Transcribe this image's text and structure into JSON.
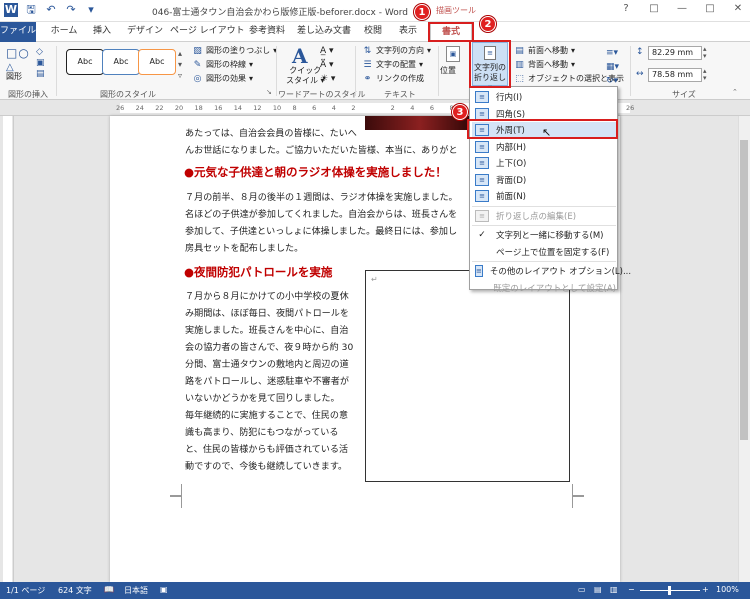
{
  "window": {
    "title": "046-富士通タウン自治会かわら版修正版-beforer.docx - Word",
    "context_tools_label": "描画ツール",
    "buttons": [
      "?",
      "□",
      "—",
      "□",
      "✕"
    ]
  },
  "tabs": [
    "ファイル",
    "ホーム",
    "挿入",
    "デザイン",
    "ページ レイアウト",
    "参考資料",
    "差し込み文書",
    "校閲",
    "表示",
    "書式"
  ],
  "active_tab": "書式",
  "ribbon": {
    "insert_shapes": {
      "label": "図形の挿入",
      "shapes_button": "図形"
    },
    "shape_styles": {
      "label": "図形のスタイル",
      "previews": [
        "Abc",
        "Abc",
        "Abc"
      ],
      "fill": "図形の塗りつぶし",
      "outline": "図形の枠線",
      "effects": "図形の効果"
    },
    "wordart": {
      "label": "ワードアートのスタイル",
      "quick_styles_line1": "クイック",
      "quick_styles_line2": "スタイル"
    },
    "text": {
      "label": "テキスト",
      "direction": "文字列の方向",
      "align": "文字の配置",
      "link": "リンクの作成"
    },
    "arrange": {
      "position": "位置",
      "wrap_line1": "文字列の",
      "wrap_line2": "折り返し",
      "bring_forward": "前面へ移動",
      "send_backward": "背面へ移動",
      "selection_pane": "オブジェクトの選択と表示"
    },
    "size": {
      "label": "サイズ",
      "height": "82.29 mm",
      "width": "78.58 mm"
    }
  },
  "ruler_ticks": [
    "26",
    "24",
    "22",
    "20",
    "18",
    "16",
    "14",
    "12",
    "10",
    "8",
    "6",
    "4",
    "2",
    "",
    "2",
    "4",
    "6",
    "8",
    "10",
    "12",
    "14",
    "16",
    "18",
    "20",
    "22",
    "24",
    "26"
  ],
  "document": {
    "lines_top": [
      "あたっては、自治会会員の皆様に、たいへ",
      "んお世話になりました。ご協力いただいた皆様、本当に、ありがと"
    ],
    "heading1": "●元気な子供達と朝のラジオ体操を実施しました！",
    "para1": [
      "７月の前半、８月の後半の１週間は、ラジオ体操を実施しました。",
      "名ほどの子供達が参加してくれました。自治会からは、班長さんを",
      "参加して、子供達といっしょに体操しました。最終日には、参加し",
      "房具セットを配布しました。"
    ],
    "heading2": "●夜間防犯パトロールを実施",
    "para2": [
      "７月から８月にかけての小中学校の夏休",
      "み期間は、ほぼ毎日、夜間パトロールを",
      "実施しました。班長さんを中心に、自治",
      "会の協力者の皆さんで、夜９時から約 30",
      "分間、富士通タウンの敷地内と周辺の道",
      "路をパトロールし、迷惑駐車や不審者が",
      "いないかどうかを見て回りしました。",
      "毎年継続的に実施することで、住民の意",
      "識も高まり、防犯にもつながっている",
      "と、住民の皆様からも評価されている活",
      "動ですので、今後も継続していきます。"
    ]
  },
  "wrap_menu": {
    "items": [
      {
        "label": "行内(I)",
        "icon": "inline-icon",
        "enabled": true
      },
      {
        "label": "四角(S)",
        "icon": "square-wrap-icon",
        "enabled": true
      },
      {
        "label": "外周(T)",
        "icon": "tight-wrap-icon",
        "enabled": true,
        "highlighted": true
      },
      {
        "label": "内部(H)",
        "icon": "through-wrap-icon",
        "enabled": true
      },
      {
        "label": "上下(O)",
        "icon": "top-bottom-wrap-icon",
        "enabled": true
      },
      {
        "label": "背面(D)",
        "icon": "behind-text-icon",
        "enabled": true
      },
      {
        "label": "前面(N)",
        "icon": "in-front-icon",
        "enabled": true
      },
      {
        "label": "折り返し点の編集(E)",
        "icon": "edit-wrap-points-icon",
        "enabled": false
      },
      {
        "label": "文字列と一緒に移動する(M)",
        "icon": "checkmark-icon",
        "enabled": true,
        "checked": true
      },
      {
        "label": "ページ上で位置を固定する(F)",
        "icon": "",
        "enabled": true
      },
      {
        "label": "その他のレイアウト オプション(L)...",
        "icon": "layout-options-icon",
        "enabled": true
      },
      {
        "label": "既定のレイアウトとして設定(A)",
        "icon": "",
        "enabled": false
      }
    ]
  },
  "callouts": [
    "1",
    "2",
    "3"
  ],
  "status": {
    "page": "1/1 ページ",
    "words": "624 文字",
    "language": "日本語",
    "zoom": "100%"
  },
  "colors": {
    "accent": "#2b579a",
    "callout": "#e02020",
    "heading": "#c00000",
    "context_tab": "#c0504d"
  }
}
